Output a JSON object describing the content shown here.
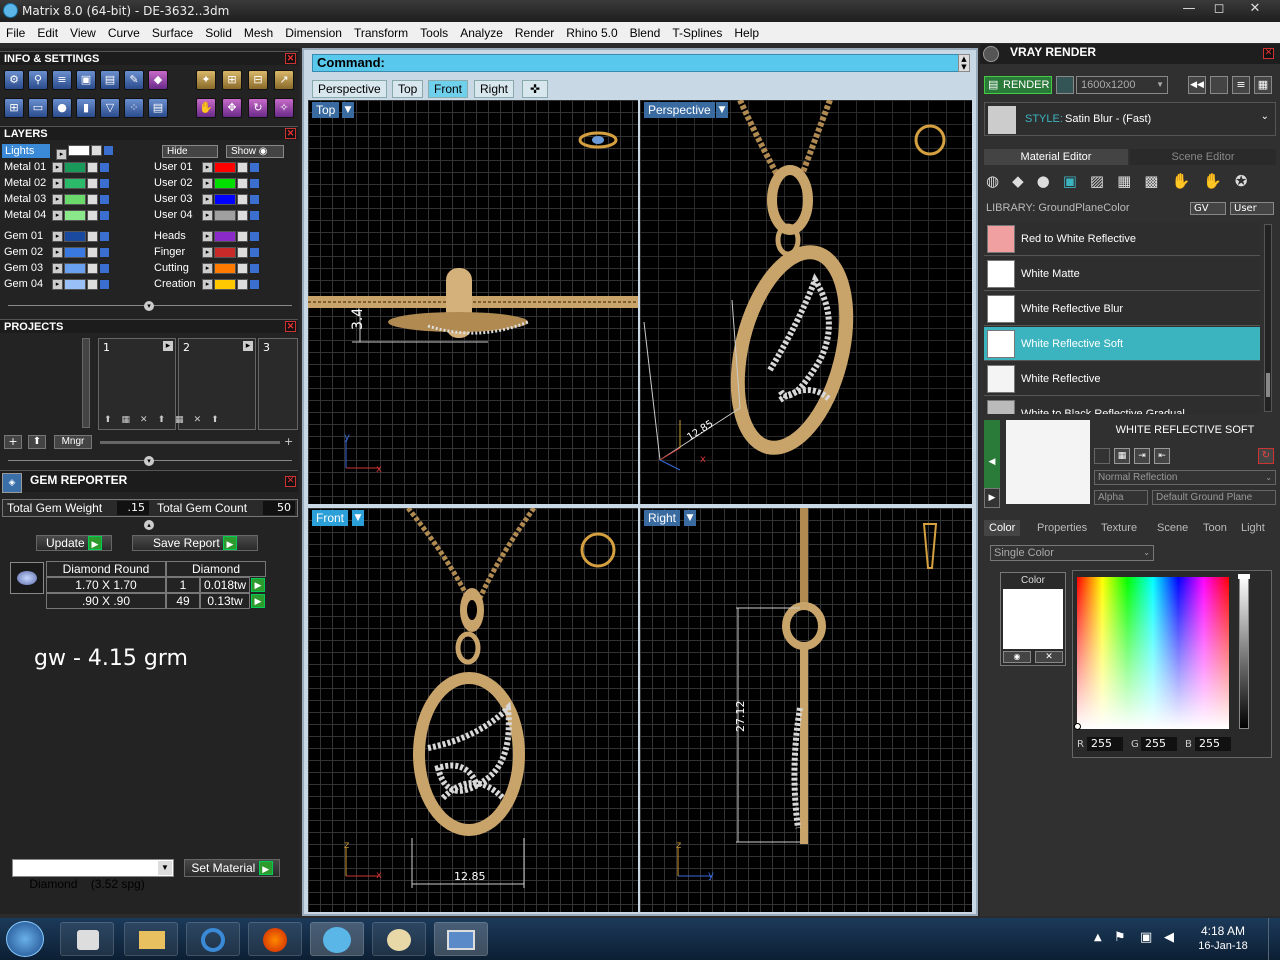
{
  "window": {
    "title": "Matrix 8.0 (64-bit) - DE-3632..3dm",
    "minimize": "—",
    "maximize": "◻",
    "close": "✕"
  },
  "menu": [
    "File",
    "Edit",
    "View",
    "Curve",
    "Surface",
    "Solid",
    "Mesh",
    "Dimension",
    "Transform",
    "Tools",
    "Analyze",
    "Render",
    "Rhino 5.0",
    "Blend",
    "T-Splines",
    "Help"
  ],
  "left": {
    "info_title": "INFO & SETTINGS",
    "layers_title": "LAYERS",
    "lights_label": "Lights",
    "hide_label": "Hide",
    "show_label": "Show",
    "layers_left": [
      {
        "name": "Metal 01",
        "color": "#1a9a5a"
      },
      {
        "name": "Metal 02",
        "color": "#2aba6a"
      },
      {
        "name": "Metal 03",
        "color": "#6ad86a"
      },
      {
        "name": "Metal 04",
        "color": "#8ae88a"
      },
      {
        "name": "Gem 01",
        "color": "#1a4aa0"
      },
      {
        "name": "Gem 02",
        "color": "#3a7ae0"
      },
      {
        "name": "Gem 03",
        "color": "#6aa0f0"
      },
      {
        "name": "Gem 04",
        "color": "#9ac0f8"
      }
    ],
    "layers_right": [
      {
        "name": "User 01",
        "color": "#ff0000"
      },
      {
        "name": "User 02",
        "color": "#00e000"
      },
      {
        "name": "User 03",
        "color": "#0000ff"
      },
      {
        "name": "User 04",
        "color": "#a0a0a0"
      },
      {
        "name": "Heads",
        "color": "#8a2ac8"
      },
      {
        "name": "Finger",
        "color": "#c82a2a"
      },
      {
        "name": "Cutting",
        "color": "#ff7a00"
      },
      {
        "name": "Creation",
        "color": "#ffc800"
      }
    ],
    "projects_title": "PROJECTS",
    "project_slots": [
      "1",
      "2",
      "3"
    ],
    "mngr_label": "Mngr",
    "gem_title": "GEM REPORTER",
    "total_weight_label": "Total Gem Weight",
    "total_weight_value": ".15",
    "total_count_label": "Total Gem Count",
    "total_count_value": "50",
    "update_label": "Update",
    "save_report_label": "Save Report",
    "gem_header": [
      "Diamond Round",
      "Diamond"
    ],
    "gem_rows": [
      {
        "size": "1.70 X 1.70",
        "count": "1",
        "weight": "0.018tw"
      },
      {
        "size": ".90 X .90",
        "count": "49",
        "weight": "0.13tw"
      }
    ],
    "note": "gw - 4.15 grm",
    "material_select": "Diamond    (3.52 spg)",
    "set_material_label": "Set Material"
  },
  "center": {
    "command_label": "Command:",
    "tabs": [
      "Perspective",
      "Top",
      "Front",
      "Right"
    ],
    "active_tab": "Front",
    "viewports": {
      "top": "Top",
      "perspective": "Perspective",
      "front": "Front",
      "right": "Right"
    },
    "dims": {
      "top_height": "3.4",
      "persp_width": "12.85",
      "front_width": "12.85",
      "right_height": "27.12"
    },
    "axes": {
      "x": "x",
      "y": "y",
      "z": "z"
    }
  },
  "right": {
    "title": "VRAY RENDER",
    "render_label": "RENDER",
    "resolution": "1600x1200",
    "style_label": "STYLE:",
    "style_value": "Satin Blur - (Fast)",
    "tab_material": "Material Editor",
    "tab_scene": "Scene Editor",
    "library_label": "LIBRARY: GroundPlaneColor",
    "gv_label": "GV",
    "user_label": "User",
    "materials": [
      {
        "name": "Red to White Reflective",
        "color": "#f0a0a0"
      },
      {
        "name": "White Matte",
        "color": "#ffffff"
      },
      {
        "name": "White Reflective Blur",
        "color": "#ffffff"
      },
      {
        "name": "White Reflective Soft",
        "color": "#ffffff"
      },
      {
        "name": "White Reflective",
        "color": "#f4f4f4"
      },
      {
        "name": "White to Black Reflective Gradual",
        "color": "#bbbbbb"
      }
    ],
    "selected_material": "WHITE REFLECTIVE SOFT",
    "reflection_mode": "Normal Reflection",
    "alpha_label": "Alpha",
    "ground_label": "Default Ground Plane",
    "bottom_tabs": [
      "Color",
      "Properties",
      "Texture",
      "Scene",
      "Toon",
      "Light"
    ],
    "color_mode": "Single Color",
    "color_label": "Color",
    "rgb": {
      "r_label": "R",
      "r": "255",
      "g_label": "G",
      "g": "255",
      "b_label": "B",
      "b": "255"
    }
  },
  "taskbar": {
    "time": "4:18 AM",
    "date": "16-Jan-18"
  }
}
